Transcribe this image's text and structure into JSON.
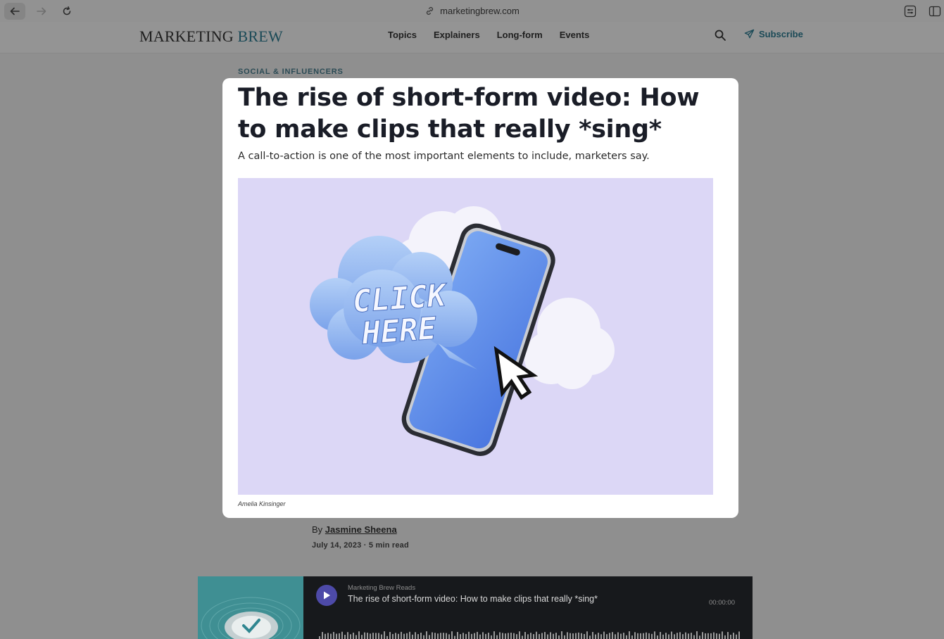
{
  "browser": {
    "url": "marketingbrew.com"
  },
  "site": {
    "logo_main": "Marketing",
    "logo_accent": "Brew",
    "nav": [
      "Topics",
      "Explainers",
      "Long-form",
      "Events"
    ],
    "subscribe_label": "Subscribe"
  },
  "article": {
    "category": "SOCIAL & INFLUENCERS",
    "headline": "The rise of short-form video: How to make clips that really *sing*",
    "dek": "A call-to-action is one of the most important elements to include, marketers say.",
    "hero_text_line1": "CLICK",
    "hero_text_line2": "HERE",
    "caption": "Amelia Kinsinger",
    "byline_prefix": "By",
    "author": "Jasmine Sheena",
    "date": "July 14, 2023",
    "read_time": "· 5 min read"
  },
  "player": {
    "label": "Marketing Brew Reads",
    "title": "The rise of short-form video: How to make clips that really *sing*",
    "time": "00:00:00"
  },
  "colors": {
    "accent": "#1b4a57",
    "hero_bg": "#dcd7f6",
    "phone_blue": "#5b8de8",
    "player_bg": "#17191c",
    "play_button": "#4d4aa8"
  }
}
